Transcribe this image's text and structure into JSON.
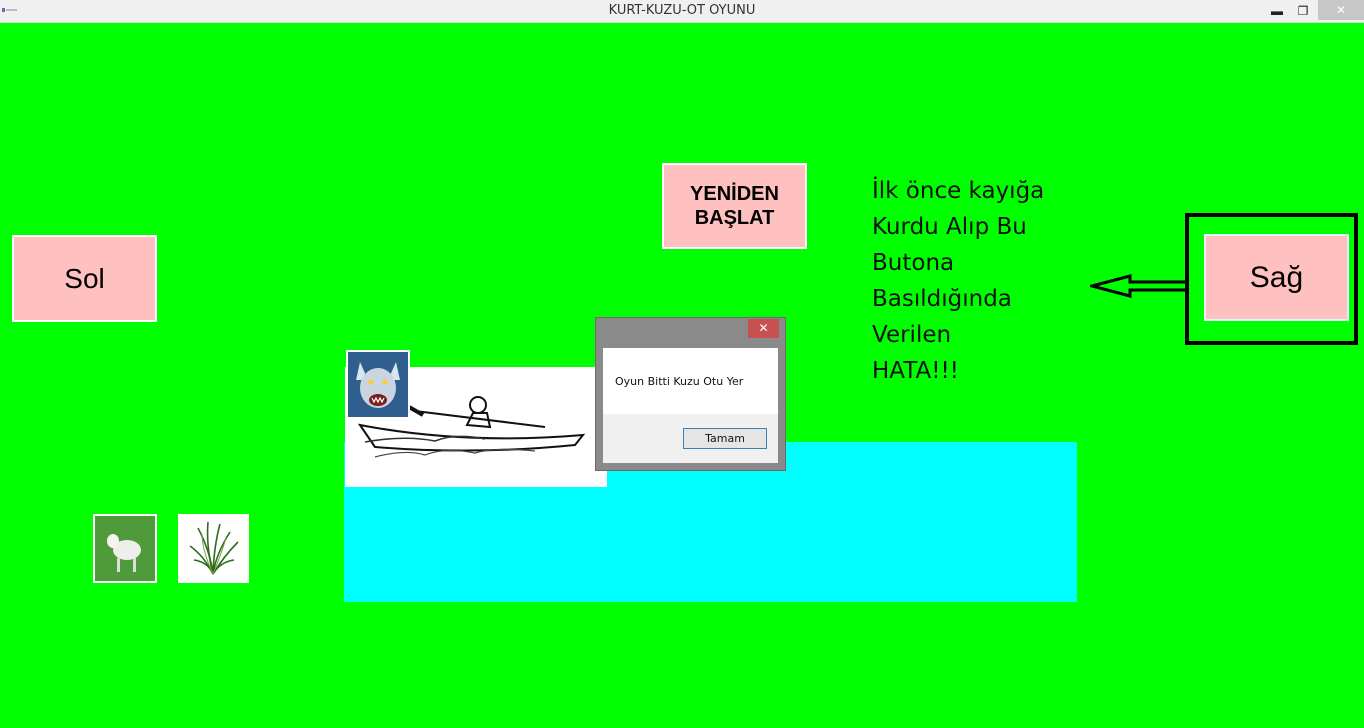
{
  "window": {
    "title": "KURT-KUZU-OT OYUNU",
    "minimize_glyph": "▬",
    "restore_glyph": "❐",
    "close_glyph": "✕"
  },
  "game": {
    "left_button": "Sol",
    "right_button": "Sağ",
    "restart_button_line1": "YENİDEN",
    "restart_button_line2": "BAŞLAT",
    "annotation_lines": [
      "İlk önce kayığa",
      "Kurdu Alıp Bu",
      "Butona",
      "Basıldığında",
      "Verilen",
      "HATA!!!"
    ]
  },
  "dialog": {
    "message": "Oyun Bitti Kuzu Otu Yer",
    "ok_label": "Tamam",
    "close_glyph": "✕"
  },
  "colors": {
    "background": "#00ff00",
    "button": "#ffc0c0",
    "river": "#00ffff",
    "dialog_close": "#c75050"
  },
  "icons": [
    "wolf-image",
    "boat-image",
    "sheep-image",
    "grass-image",
    "arrow-left"
  ]
}
